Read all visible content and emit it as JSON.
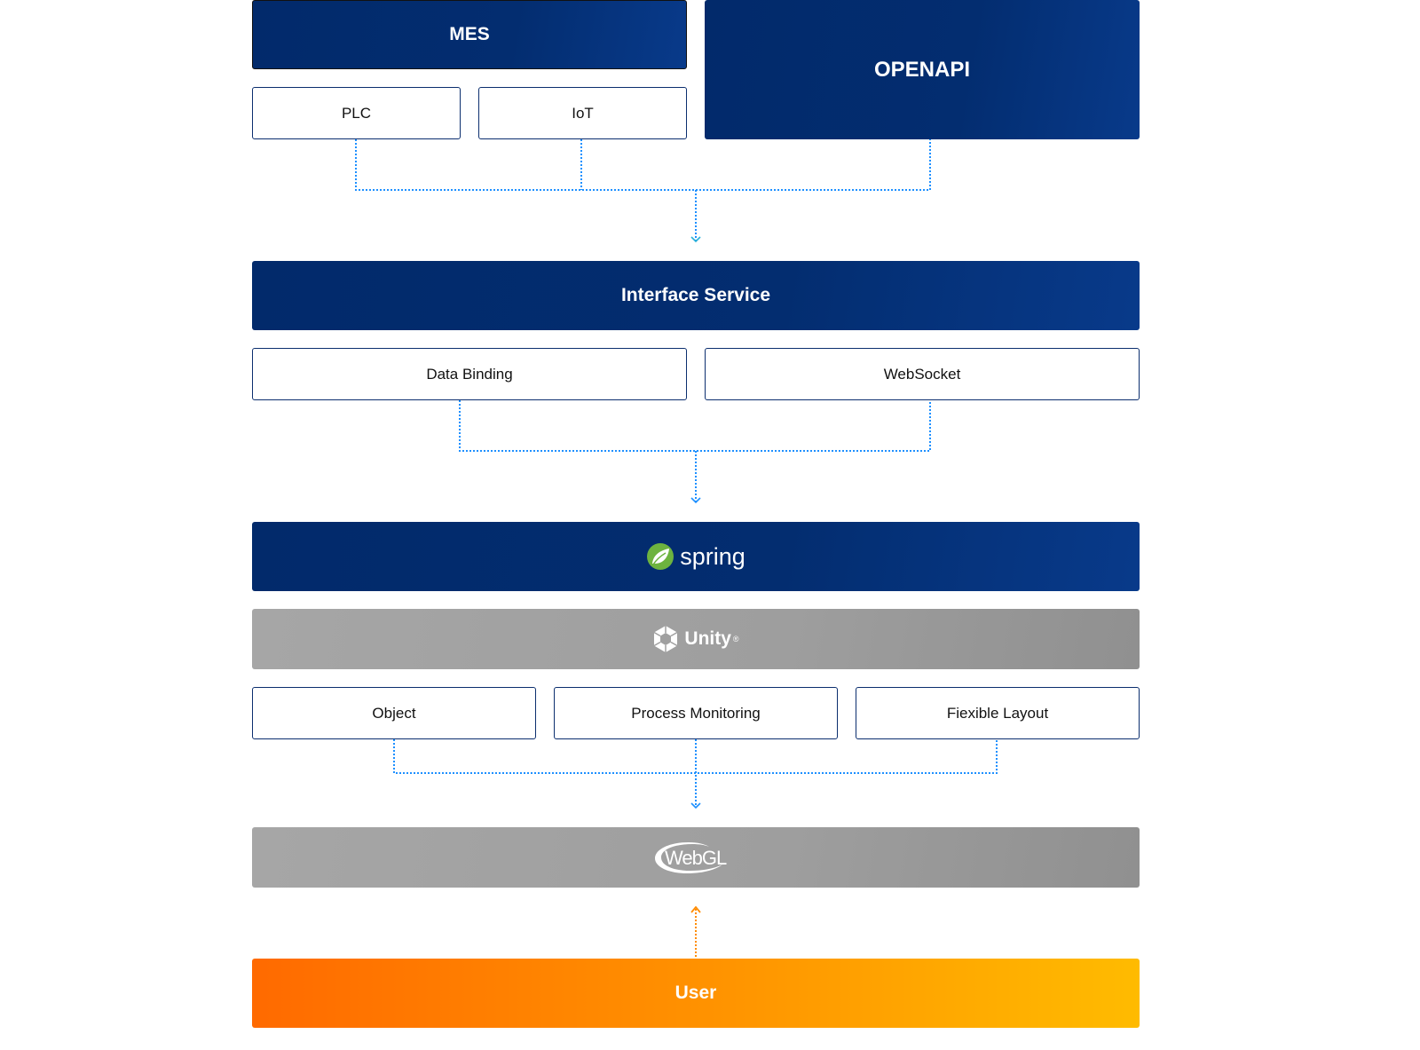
{
  "sources": {
    "mes": "MES",
    "openapi": "OPENAPI",
    "plc": "PLC",
    "iot": "IoT"
  },
  "interface": {
    "title": "Interface Service",
    "data_binding": "Data Binding",
    "websocket": "WebSocket"
  },
  "spring": {
    "logo_text": "spring",
    "leaf_color": "#6db33f"
  },
  "unity": {
    "logo_text": "Unity",
    "modules": [
      "Object",
      "Process Monitoring",
      "Fiexible Layout"
    ]
  },
  "webgl": {
    "logo_text": "WebGL"
  },
  "user": {
    "label": "User"
  },
  "colors": {
    "navy": "#032d70",
    "connector": "#1e90ff",
    "user_arrow": "#ff8c00",
    "gray": "#a0a0a0"
  }
}
